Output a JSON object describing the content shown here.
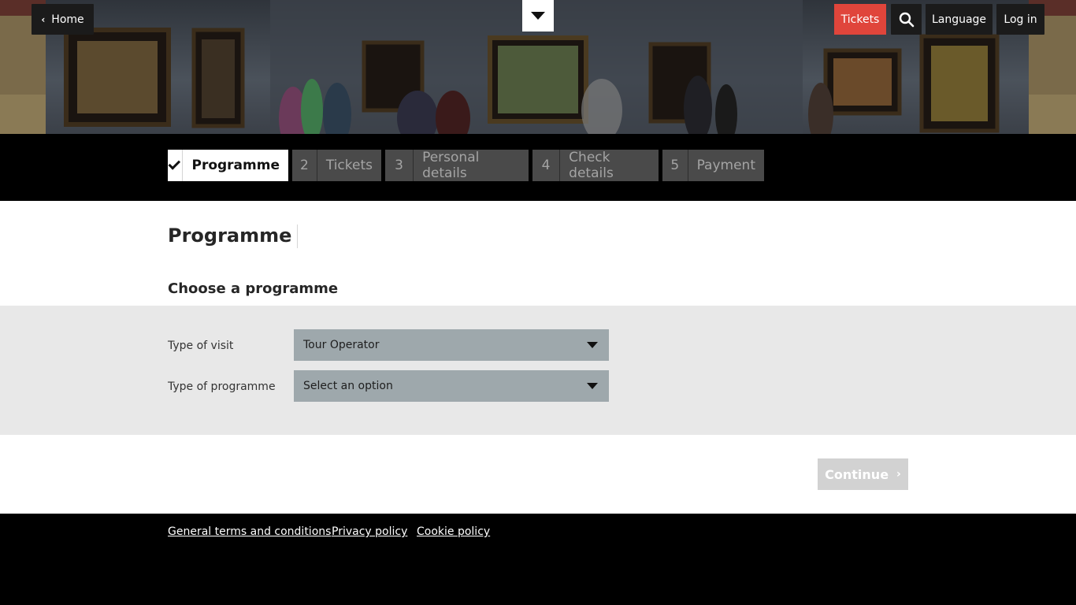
{
  "header": {
    "home_label": "Home",
    "tickets_label": "Tickets",
    "language_label": "Language",
    "login_label": "Log in",
    "icons": {
      "home": "chevron-left-icon",
      "menu": "caret-down-icon",
      "search": "search-icon"
    },
    "colors": {
      "tickets": "#e0453b",
      "dark_button": "#1b1b1b"
    }
  },
  "steps": [
    {
      "number": "",
      "label": "Programme",
      "state": "completed-active"
    },
    {
      "number": "2",
      "label": "Tickets",
      "state": "inactive"
    },
    {
      "number": "3",
      "label": "Personal details",
      "state": "inactive"
    },
    {
      "number": "4",
      "label": "Check details",
      "state": "inactive"
    },
    {
      "number": "5",
      "label": "Payment",
      "state": "inactive"
    }
  ],
  "main": {
    "title": "Programme",
    "section_title": "Choose a programme",
    "fields": [
      {
        "label": "Type of visit",
        "value": "Tour Operator"
      },
      {
        "label": "Type of programme",
        "value": "Select an option"
      }
    ],
    "continue_label": "Continue"
  },
  "footer": {
    "links": [
      "General terms and conditions",
      "Privacy policy",
      "Cookie policy"
    ]
  }
}
